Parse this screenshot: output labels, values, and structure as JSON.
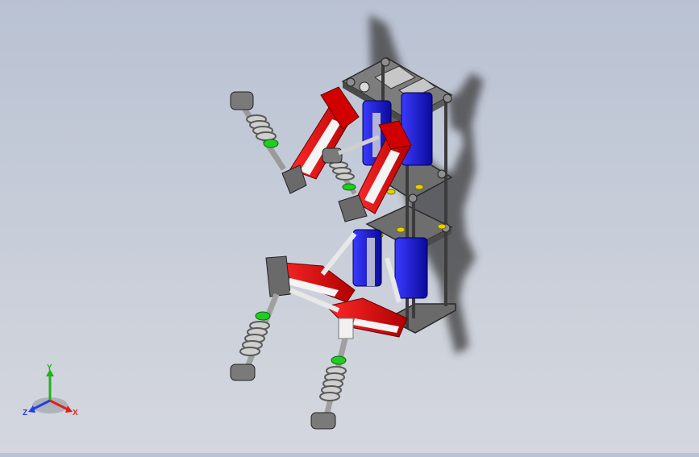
{
  "view": {
    "title": "",
    "colors": {
      "background_top": "#b9c2d3",
      "background_bottom": "#d4d7de",
      "frame": "#6b6b6b",
      "arm": "#e00000",
      "motor": "#1a1ae6",
      "shaft": "#f0f0f0",
      "spring": "#b0b0b0",
      "ring_green": "#22cc22",
      "nut_yellow": "#e6d200",
      "shadow": "#3a3a3a"
    }
  },
  "triad": {
    "x_label": "X",
    "y_label": "Y",
    "z_label": "Z",
    "x_color": "#e02020",
    "y_color": "#20b020",
    "z_color": "#2040e0"
  }
}
